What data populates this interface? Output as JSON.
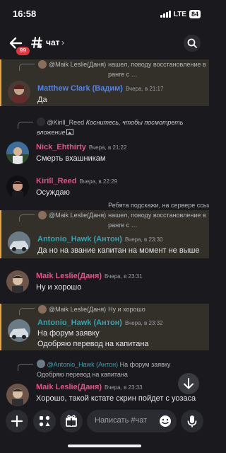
{
  "status": {
    "time": "16:58",
    "network": "LTE",
    "battery": "84"
  },
  "header": {
    "unread_badge": "99",
    "channel": "чат",
    "chevron": "›"
  },
  "messages": [
    {
      "reply": {
        "author": "@Maik Leslie(Даня)",
        "text": "Ребята подскажи, на сервере ссылку нашел, поводу восстановление в ранге с …"
      },
      "author": "Matthew Clark (Вадим)",
      "time": "Вчера, в 21:17",
      "text": "Да",
      "highlight": true
    },
    {
      "reply": {
        "author": "@Kirill_Reed",
        "text": "Коснитесь, чтобы посмотреть вложение"
      },
      "author": "Nick_Ehthirty",
      "time": "Вчера, в 21:22",
      "text": "Смерть вхашникам"
    },
    {
      "author": "Kirill_Reed",
      "time": "Вчера, в 22:29",
      "text": "Осуждаю"
    },
    {
      "reply": {
        "author": "@Maik Leslie(Даня)",
        "text": "Ребята подскажи, на сервере ссылку нашел, поводу восстановление в ранге с …"
      },
      "author": "Antonio_Hawk (Антон)",
      "time": "Вчера, в 23:30",
      "text": "Да но на звание капитан на момент не выше",
      "highlight": true
    },
    {
      "author": "Maik Leslie(Даня)",
      "time": "Вчера, в 23:31",
      "text": "Ну и хорошо"
    },
    {
      "reply": {
        "author": "@Maik Leslie(Даня)",
        "text": "Ну и хорошо"
      },
      "author": "Antonio_Hawk (Антон)",
      "time": "Вчера, в 23:32",
      "text": "На форум заявку",
      "text2": "Одобряю перевод на капитана",
      "highlight": true
    },
    {
      "reply": {
        "author": "@Antonio_Hawk (Антон)",
        "text": "На форум заявку",
        "text2": "Одобряю перевод на капитана"
      },
      "author": "Maik Leslie(Даня)",
      "time": "Вчера, в 23:33",
      "text": "Хорошо, такой кстате скрин пойдет с уозаса"
    }
  ],
  "composer": {
    "placeholder": "Написать #чат"
  },
  "colors": {
    "highlight_bar": "#e6a63b",
    "highlight_bg": "#33302a",
    "blue_name": "#4f83ef",
    "pink_name": "#e0548a",
    "teal_name": "#34a4b3"
  }
}
